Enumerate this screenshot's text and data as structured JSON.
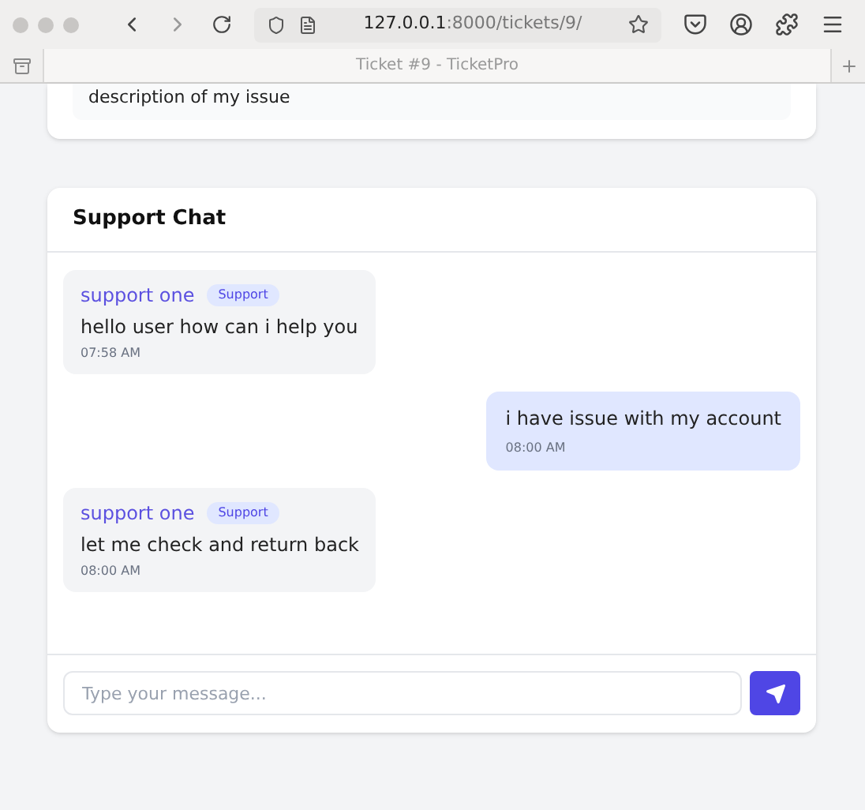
{
  "browser": {
    "url_host": "127.0.0.1",
    "url_path": ":8000/tickets/9/",
    "tab_title": "Ticket #9 - TicketPro"
  },
  "ticket": {
    "description": "description of my issue"
  },
  "chat": {
    "title": "Support Chat",
    "messages": [
      {
        "kind": "agent",
        "sender": "support one",
        "role": "Support",
        "text": "hello user how can i help you",
        "time": "07:58 AM"
      },
      {
        "kind": "user",
        "text": "i have issue with my account",
        "time": "08:00 AM"
      },
      {
        "kind": "agent",
        "sender": "support one",
        "role": "Support",
        "text": "let me check and return back",
        "time": "08:00 AM"
      }
    ],
    "input": {
      "placeholder": "Type your message..."
    }
  }
}
